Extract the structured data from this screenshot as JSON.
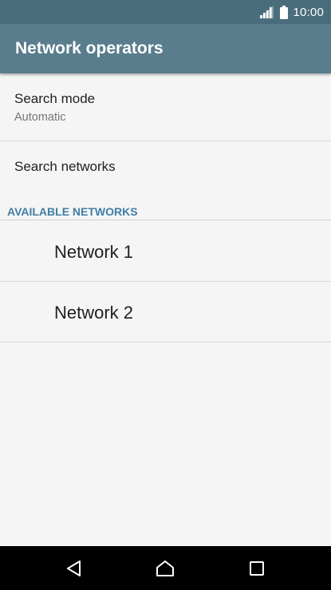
{
  "status_bar": {
    "time": "10:00",
    "icons": [
      "signal-icon",
      "battery-icon"
    ]
  },
  "app_bar": {
    "title": "Network operators"
  },
  "preferences": {
    "search_mode": {
      "title": "Search mode",
      "summary": "Automatic"
    },
    "search_networks": {
      "title": "Search networks"
    }
  },
  "available_networks": {
    "header": "AVAILABLE NETWORKS",
    "items": [
      {
        "label": "Network 1"
      },
      {
        "label": "Network 2"
      }
    ]
  },
  "nav_bar": {
    "icons": [
      "back-icon",
      "home-icon",
      "recents-icon"
    ]
  },
  "colors": {
    "status_bar_bg": "#4a6d7c",
    "app_bar_bg": "#5a7d8e",
    "accent": "#3f7fa6",
    "background": "#f5f5f5",
    "nav_bar_bg": "#000000"
  }
}
